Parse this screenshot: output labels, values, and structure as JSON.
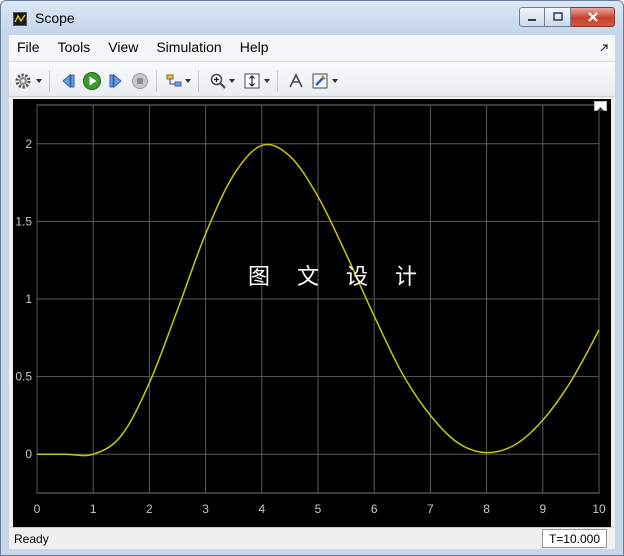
{
  "window": {
    "title": "Scope"
  },
  "menu": [
    "File",
    "Tools",
    "View",
    "Simulation",
    "Help"
  ],
  "toolbar": {
    "items": [
      "gear-icon",
      "step-back-icon",
      "run-icon",
      "step-forward-icon",
      "stop-icon",
      "highlight-model-icon",
      "zoom-in-icon",
      "scale-axes-icon",
      "cursor-measure-icon",
      "style-icon"
    ]
  },
  "plot": {
    "watermark": "图 文 设 计",
    "line_color": "#c8c800",
    "background": "#000000",
    "grid_color": "#5a5a5a"
  },
  "chart_data": {
    "type": "line",
    "title": "",
    "xlabel": "",
    "ylabel": "",
    "xlim": [
      0,
      10
    ],
    "ylim": [
      -0.25,
      2.25
    ],
    "xticks": [
      0,
      1,
      2,
      3,
      4,
      5,
      6,
      7,
      8,
      9,
      10
    ],
    "yticks": [
      0,
      0.5,
      1,
      1.5,
      2
    ],
    "xtick_labels": [
      "0",
      "1",
      "2",
      "3",
      "4",
      "5",
      "6",
      "7",
      "8",
      "9",
      "10"
    ],
    "ytick_labels": [
      "0",
      "0.5",
      "1",
      "1.5",
      "2"
    ],
    "grid": true,
    "series": [
      {
        "x": [
          0,
          0.5,
          1.0,
          1.5,
          2.0,
          2.5,
          3.0,
          3.5,
          4.0,
          4.5,
          5.0,
          5.5,
          6.0,
          6.5,
          7.0,
          7.5,
          8.0,
          8.5,
          9.0,
          9.5,
          10.0
        ],
        "values": [
          0,
          0,
          0,
          0.12,
          0.46,
          0.93,
          1.42,
          1.8,
          1.99,
          1.92,
          1.66,
          1.29,
          0.89,
          0.52,
          0.25,
          0.07,
          0.01,
          0.06,
          0.22,
          0.47,
          0.8
        ]
      }
    ]
  },
  "status": {
    "left": "Ready",
    "right": "T=10.000"
  }
}
